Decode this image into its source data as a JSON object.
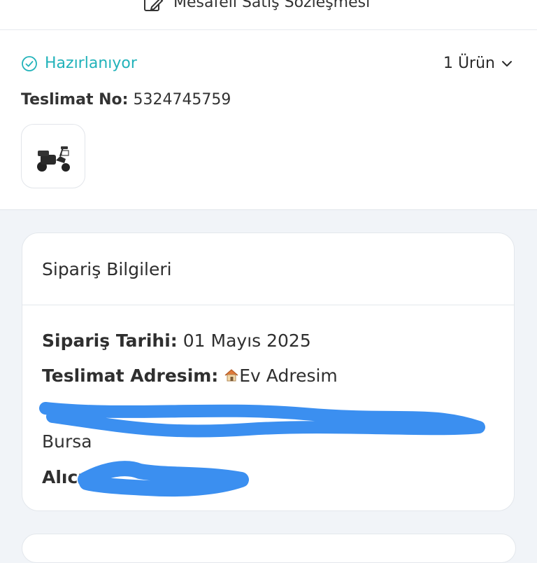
{
  "contract_link": {
    "label": "Mesafeli Satış Sözleşmesi",
    "icon": "edit-document-icon"
  },
  "order": {
    "status": "Hazırlanıyor",
    "status_icon": "check-circle-icon",
    "item_count": "1 Ürün",
    "delivery_no_label": "Teslimat No:",
    "delivery_no": "5324745759",
    "product_image": "electric-tricycle"
  },
  "order_info": {
    "title": "Sipariş Bilgileri",
    "date_label": "Sipariş Tarihi:",
    "date_value": "01 Mayıs 2025",
    "address_label": "Teslimat Adresim:",
    "address_name": "Ev Adresim",
    "address_city": "Bursa",
    "recipient_label": "Alıcı"
  },
  "colors": {
    "accent": "#22b3ba",
    "background": "#f1f4f8",
    "scribble": "#3b8ff0"
  }
}
